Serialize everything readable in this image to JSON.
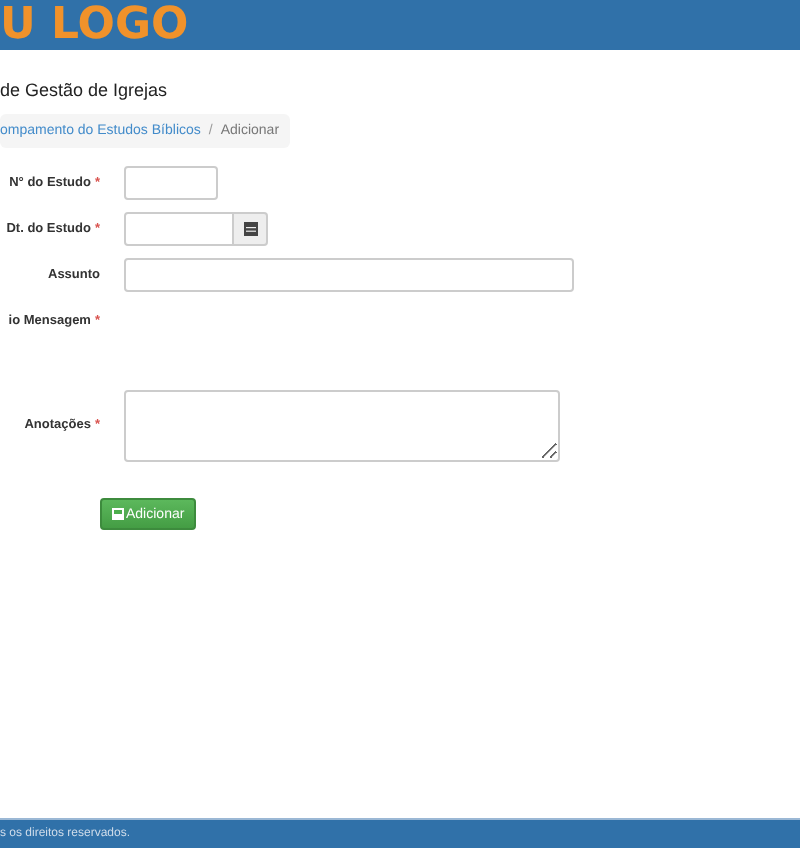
{
  "header": {
    "logo": "U LOGO"
  },
  "page_title": "de Gestão de Igrejas",
  "breadcrumb": [
    {
      "label": "ompamento do Estudos Bíblicos",
      "kind": "link"
    },
    {
      "label": "/",
      "kind": "separator"
    },
    {
      "label": "Adicionar",
      "kind": "current"
    }
  ],
  "form": {
    "fields": [
      {
        "label": "N° do Estudo",
        "mark": "*",
        "kind": "short"
      },
      {
        "label": "Dt. do Estudo",
        "mark": "*",
        "kind": "date"
      },
      {
        "label": "Assunto",
        "kind": "text"
      },
      {
        "label": "io Mensagem",
        "mark": "*",
        "kind": "empty"
      },
      {
        "label": "Anotações",
        "mark": "*",
        "kind": "textarea"
      }
    ],
    "submit": "Adicionar"
  },
  "footer": "s os direitos reservados."
}
